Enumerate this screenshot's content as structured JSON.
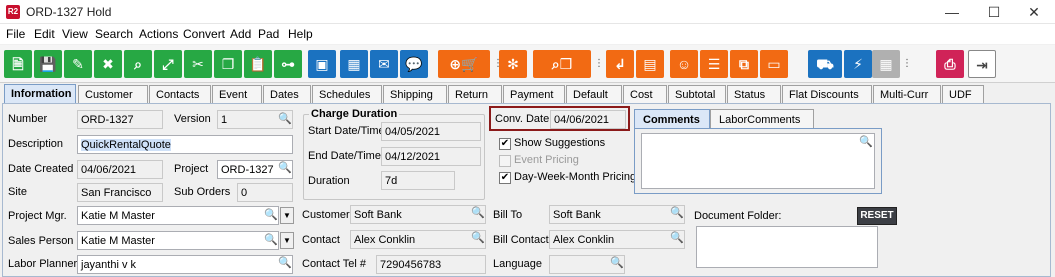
{
  "window": {
    "app_icon_text": "R2",
    "title": "ORD-1327 Hold",
    "minimize": "—",
    "maximize": "☐",
    "close": "✕"
  },
  "menu": [
    "File",
    "Edit",
    "View",
    "Search",
    "Actions",
    "Convert",
    "Add",
    "Pad",
    "Help"
  ],
  "tabs": [
    "Information",
    "Customer",
    "Contacts",
    "Event",
    "Dates",
    "Schedules",
    "Shipping",
    "Return",
    "Payment",
    "Default",
    "Cost",
    "Subtotal",
    "Status",
    "Flat Discounts",
    "Multi-Curr",
    "UDF"
  ],
  "active_tab": "Information",
  "form": {
    "number_label": "Number",
    "number_value": "ORD-1327",
    "version_label": "Version",
    "version_value": "1",
    "description_label": "Description",
    "description_value": "QuickRentalQuote",
    "date_created_label": "Date Created",
    "date_created_value": "04/06/2021",
    "project_label": "Project",
    "project_value": "ORD-1327",
    "site_label": "Site",
    "site_value": "San Francisco",
    "sub_orders_label": "Sub Orders",
    "sub_orders_value": "0",
    "charge_duration_title": "Charge Duration",
    "start_label": "Start Date/Time",
    "start_value": "04/05/2021",
    "end_label": "End Date/Time",
    "end_value": "04/12/2021",
    "duration_label": "Duration",
    "duration_value": "7d",
    "conv_date_label": "Conv. Date",
    "conv_date_value": "04/06/2021",
    "show_suggestions_label": "Show Suggestions",
    "show_suggestions_checked": "✔",
    "event_pricing_label": "Event Pricing",
    "dwm_pricing_label": "Day-Week-Month Pricing",
    "dwm_pricing_checked": "✔",
    "comments_tab": "Comments",
    "labor_comments_tab": "LaborComments",
    "project_mgr_label": "Project Mgr.",
    "project_mgr_value": "Katie M Master",
    "sales_person_label": "Sales Person",
    "sales_person_value": "Katie M Master",
    "labor_planner_label": "Labor Planner",
    "labor_planner_value": "jayanthi v k",
    "customer_label": "Customer",
    "customer_value": "Soft Bank",
    "contact_label": "Contact",
    "contact_value": "Alex Conklin",
    "contact_tel_label": "Contact Tel #",
    "contact_tel_value": "7290456783",
    "bill_to_label": "Bill To",
    "bill_to_value": "Soft Bank",
    "bill_contact_label": "Bill Contact",
    "bill_contact_value": "Alex Conklin",
    "language_label": "Language",
    "language_value": "",
    "document_folder_label": "Document Folder:",
    "reset_label": "RESET"
  },
  "glyphs": {
    "search": "🔍",
    "dropdown": "▼"
  },
  "colors": {
    "green": "#27a844",
    "blue": "#1b72c0",
    "orange": "#f26a13",
    "highlight_border": "#8b1a1a"
  }
}
